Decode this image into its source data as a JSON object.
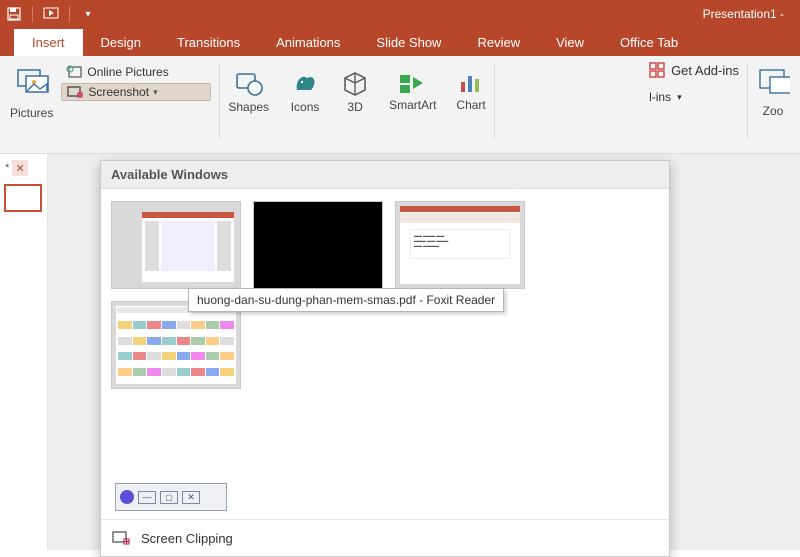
{
  "title": "Presentation1 -",
  "tabs": [
    "Insert",
    "Design",
    "Transitions",
    "Animations",
    "Slide Show",
    "Review",
    "View",
    "Office Tab"
  ],
  "active_tab": "Insert",
  "ribbon": {
    "pictures_label": "Pictures",
    "online_pictures": "Online Pictures",
    "screenshot": "Screenshot",
    "shapes": "Shapes",
    "icons": "Icons",
    "threeD": "3D",
    "smartart": "SmartArt",
    "chart": "Chart",
    "get_addins": "Get Add-ins",
    "addins_drop": "l-ins",
    "zoom": "Zoo"
  },
  "dropdown": {
    "header": "Available Windows",
    "tooltip": "huong-dan-su-dung-phan-mem-smas.pdf - Foxit Reader",
    "screen_clipping": "Screen Clipping"
  },
  "close_glyph": "✕",
  "star_glyph": "*",
  "chevron": "▾"
}
